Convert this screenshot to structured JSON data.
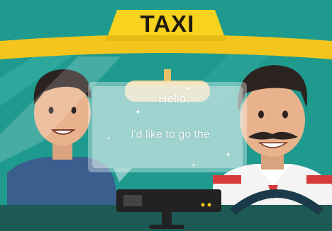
{
  "sign": {
    "text": "TAXI"
  },
  "bubble": {
    "greeting": "Hello.",
    "request": "I'd like to go the"
  },
  "colors": {
    "sky_teal": "#1f9a8f",
    "sign_yellow": "#f7d21e",
    "roof_yellow": "#f3c51d",
    "dashboard": "#1d5a55",
    "driver_shirt": "#f4f4f4",
    "driver_collar_red": "#d83a3a",
    "passenger_shirt": "#3a5f8e"
  },
  "icons": {
    "rear_view_mirror": "mirror-icon",
    "taximeter": "taximeter-icon",
    "steering_wheel": "steering-wheel-icon",
    "sparkles": "sparkle-icon"
  }
}
